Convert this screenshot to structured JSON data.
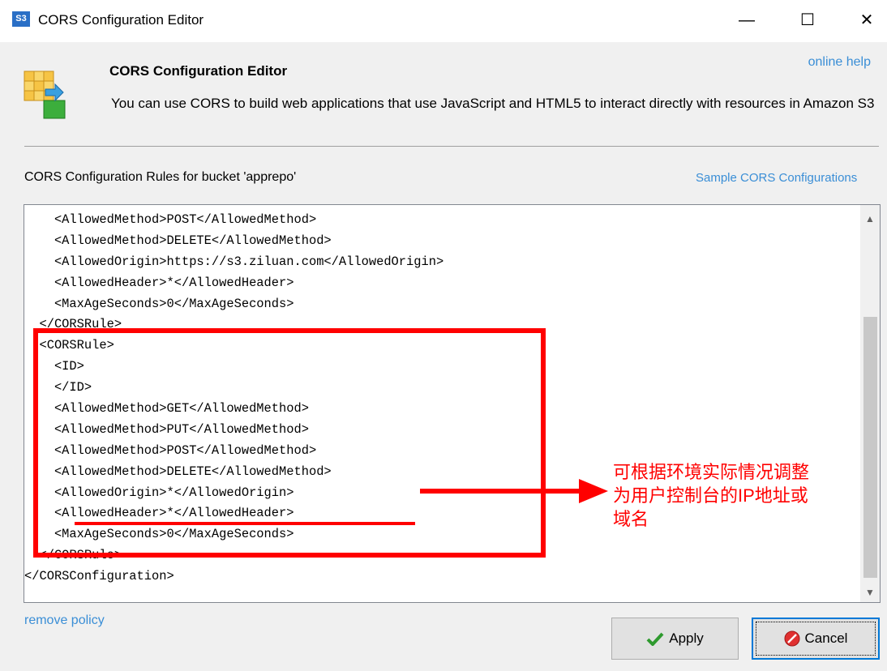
{
  "window": {
    "title": "CORS Configuration Editor",
    "app_badge": "S3",
    "controls": {
      "minimize": "—",
      "maximize": "☐",
      "close": "✕"
    }
  },
  "header": {
    "title": "CORS Configuration Editor",
    "description": "You can use CORS to build web applications that use JavaScript and HTML5 to interact directly with resources in Amazon S3",
    "online_help": "online help"
  },
  "rules_label": "CORS Configuration Rules for bucket 'apprepo'",
  "sample_link": "Sample CORS Configurations",
  "editor": {
    "lines": [
      "    <AllowedMethod>POST</AllowedMethod>",
      "    <AllowedMethod>DELETE</AllowedMethod>",
      "    <AllowedOrigin>https://s3.ziluan.com</AllowedOrigin>",
      "    <AllowedHeader>*</AllowedHeader>",
      "    <MaxAgeSeconds>0</MaxAgeSeconds>",
      "  </CORSRule>",
      "  <CORSRule>",
      "    <ID>",
      "    </ID>",
      "    <AllowedMethod>GET</AllowedMethod>",
      "    <AllowedMethod>PUT</AllowedMethod>",
      "    <AllowedMethod>POST</AllowedMethod>",
      "    <AllowedMethod>DELETE</AllowedMethod>",
      "    <AllowedOrigin>*</AllowedOrigin>",
      "    <AllowedHeader>*</AllowedHeader>",
      "    <MaxAgeSeconds>0</MaxAgeSeconds>",
      "  </CORSRule>",
      "</CORSConfiguration>"
    ]
  },
  "annotation": {
    "line1": "可根据环境实际情况调整",
    "line2": "为用户控制台的IP地址或",
    "line3": "域名",
    "color": "#ff0000"
  },
  "footer": {
    "remove_policy": "remove policy",
    "apply": "Apply",
    "cancel": "Cancel"
  },
  "icons": {
    "header_icon": "cube-export-icon",
    "apply_icon": "checkmark-icon",
    "cancel_icon": "no-entry-icon"
  }
}
